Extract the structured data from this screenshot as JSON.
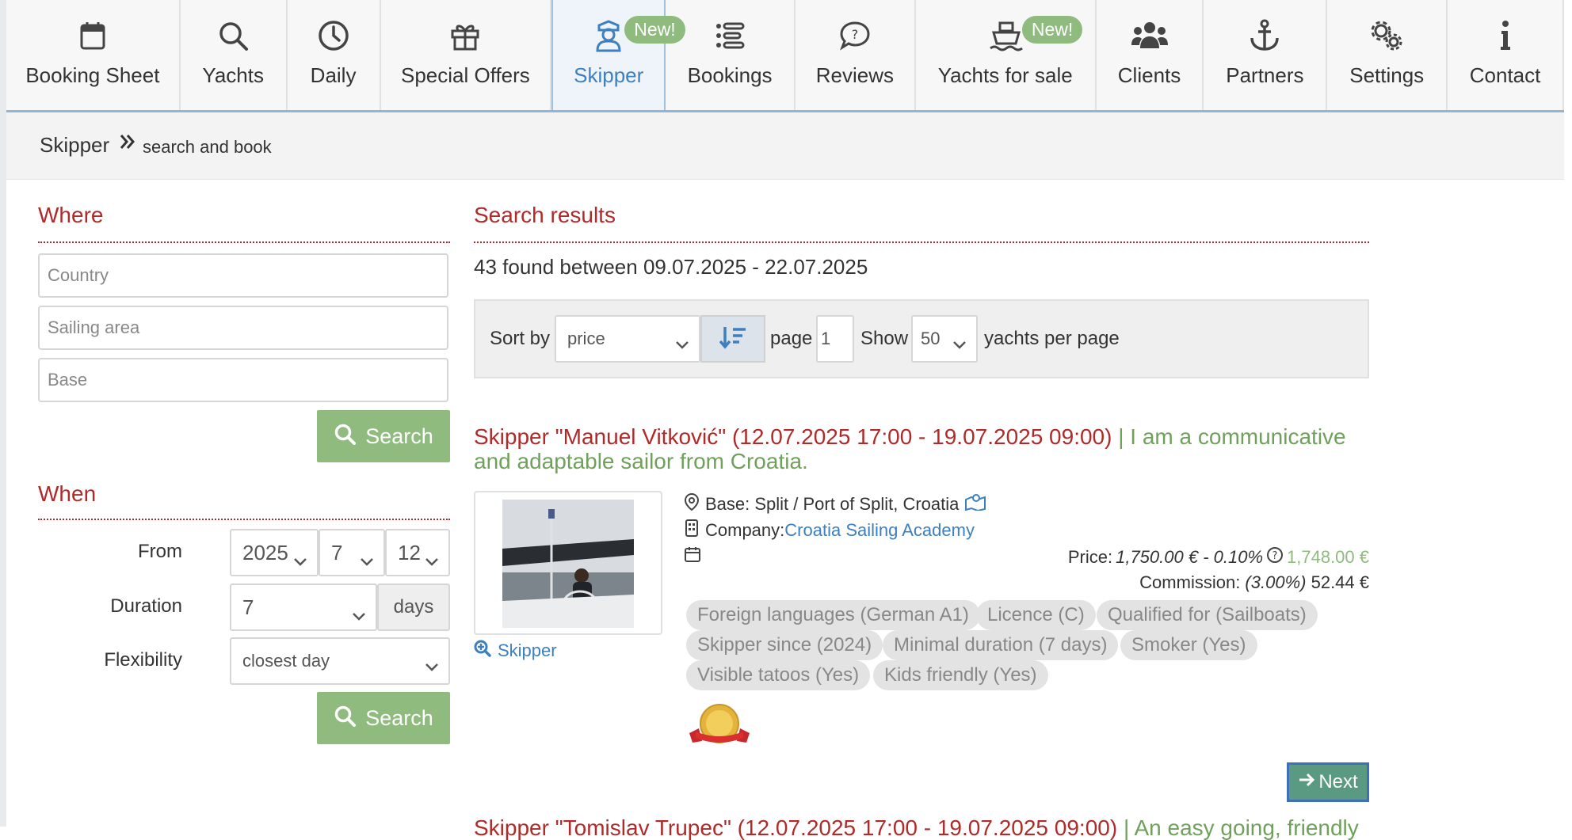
{
  "nav": {
    "items": [
      {
        "label": "Booking Sheet",
        "icon": "calendar-icon"
      },
      {
        "label": "Yachts",
        "icon": "search-icon"
      },
      {
        "label": "Daily",
        "icon": "clock-icon"
      },
      {
        "label": "Special Offers",
        "icon": "gift-icon"
      },
      {
        "label": "Skipper",
        "icon": "skipper-icon",
        "badge": "New!",
        "active": true
      },
      {
        "label": "Bookings",
        "icon": "list-icon"
      },
      {
        "label": "Reviews",
        "icon": "speech-bubble-icon"
      },
      {
        "label": "Yachts for sale",
        "icon": "ship-icon",
        "badge": "New!"
      },
      {
        "label": "Clients",
        "icon": "users-icon"
      },
      {
        "label": "Partners",
        "icon": "anchor-icon"
      },
      {
        "label": "Settings",
        "icon": "gears-icon"
      },
      {
        "label": "Contact",
        "icon": "info-icon"
      }
    ]
  },
  "breadcrumb": {
    "main": "Skipper",
    "sub": "search and book"
  },
  "where": {
    "title": "Where",
    "country_placeholder": "Country",
    "area_placeholder": "Sailing area",
    "base_placeholder": "Base",
    "search_label": "Search"
  },
  "when": {
    "title": "When",
    "from_label": "From",
    "year": "2025",
    "month": "7",
    "day": "12",
    "duration_label": "Duration",
    "duration": "7",
    "days_label": "days",
    "flex_label": "Flexibility",
    "flex": "closest day",
    "search_label": "Search"
  },
  "results": {
    "title": "Search results",
    "found": "43 found between 09.07.2025 - 22.07.2025",
    "sort_label": "Sort by",
    "sort_value": "price",
    "page_label": "page",
    "page_value": "1",
    "show_label": "Show",
    "show_value": "50",
    "per_page_label": "yachts per page"
  },
  "result1": {
    "title_red": "Skipper \"Manuel Vitković\" (12.07.2025 17:00 - 19.07.2025 09:00)",
    "title_sep": " | ",
    "title_green": "I am a communicative and adaptable sailor from Croatia.",
    "photo_link": "Skipper",
    "base": "Base: Split / Port of Split,  Croatia",
    "company_label": "Company: ",
    "company": "Croatia Sailing Academy",
    "price_label": "Price: ",
    "price_orig": "1,750.00 € - 0.10%",
    "price_final": "1,748.00 €",
    "commission_label": "Commission: ",
    "commission_pct": "(3.00%)",
    "commission_value": "52.44 €",
    "tags": [
      "Foreign languages (German A1)",
      "Licence (C)",
      "Qualified for (Sailboats)",
      "Skipper since (2024)",
      "Minimal duration (7 days)",
      "Smoker (Yes)",
      "Visible tatoos (Yes)",
      "Kids friendly (Yes)"
    ],
    "next_label": "Next"
  },
  "result2": {
    "title_red": "Skipper \"Tomislav Trupec\" (12.07.2025 17:00 - 19.07.2025 09:00)",
    "title_sep": " | ",
    "title_green": "An easy going, friendly"
  },
  "colors": {
    "accent_red": "#b02a2a",
    "green": "#8fbb7e",
    "blue": "#3e7fbf"
  }
}
